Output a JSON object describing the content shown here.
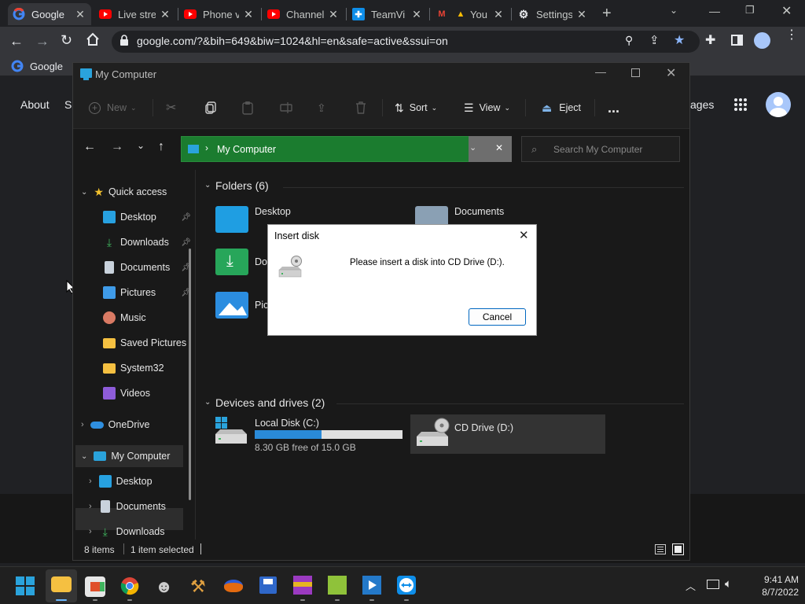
{
  "browser": {
    "tabs": [
      {
        "title": "Google",
        "icon": "google-icon",
        "active": true
      },
      {
        "title": "Live stre",
        "icon": "youtube-icon"
      },
      {
        "title": "Phone v",
        "icon": "youtube-icon"
      },
      {
        "title": "Channel",
        "icon": "youtube-icon"
      },
      {
        "title": "TeamVi",
        "icon": "teamviewer-icon"
      },
      {
        "title": "You",
        "icon": "gmail-icon"
      },
      {
        "title": "Settings",
        "icon": "gear-icon"
      }
    ],
    "url": "google.com/?&bih=649&biw=1024&hl=en&safe=active&ssui=on",
    "bookmark": "Google",
    "page": {
      "about": "About",
      "store": "S",
      "images": "ages"
    }
  },
  "explorer": {
    "title": "My Computer",
    "commands": {
      "new": "New",
      "sort": "Sort",
      "view": "View",
      "eject": "Eject",
      "more": "..."
    },
    "address": "My Computer",
    "search_placeholder": "Search My Computer",
    "sidebar": {
      "quick_access": "Quick access",
      "items": [
        "Desktop",
        "Downloads",
        "Documents",
        "Pictures",
        "Music",
        "Saved Pictures",
        "System32",
        "Videos"
      ],
      "onedrive": "OneDrive",
      "this_pc": "My Computer",
      "pc_items": [
        "Desktop",
        "Documents",
        "Downloads"
      ]
    },
    "folders_header": "Folders (6)",
    "folders": {
      "desktop": "Desktop",
      "documents": "Documents",
      "downloads_partial": "Do",
      "pictures_partial": "Pic"
    },
    "drives_header": "Devices and drives (2)",
    "drives": [
      {
        "name": "Local Disk (C:)",
        "free": "8.30 GB free of 15.0 GB",
        "used_fraction": 0.45
      },
      {
        "name": "CD Drive (D:)"
      }
    ],
    "status": {
      "items": "8 items",
      "selected": "1 item selected"
    }
  },
  "dialog": {
    "title": "Insert disk",
    "message": "Please insert a disk into CD Drive (D:).",
    "cancel": "Cancel"
  },
  "taskbar": {
    "time": "9:41 AM",
    "date": "8/7/2022"
  }
}
